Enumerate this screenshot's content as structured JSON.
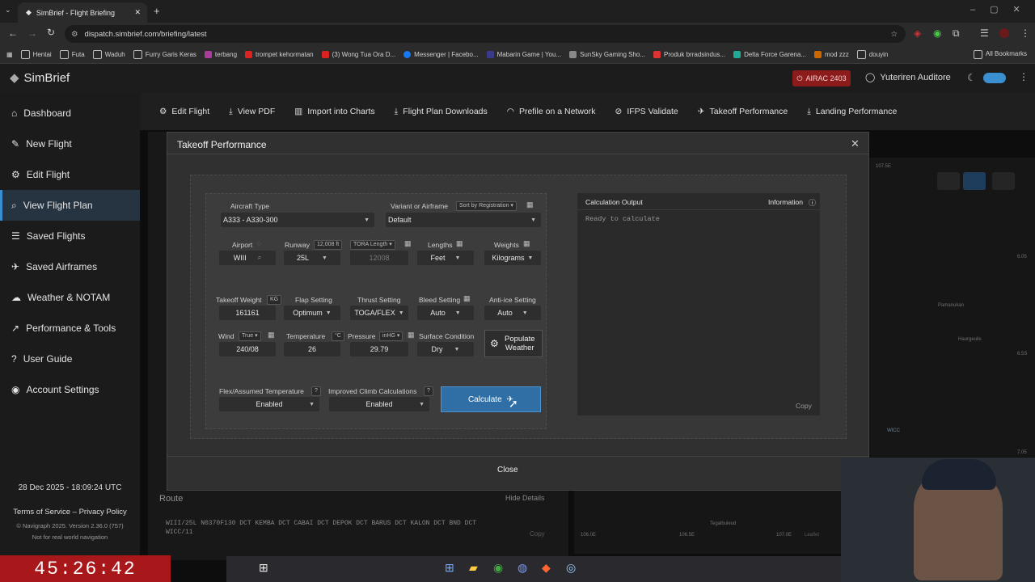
{
  "browser": {
    "tab_title": "SimBrief - Flight Briefing",
    "url": "dispatch.simbrief.com/briefing/latest",
    "bookmarks": [
      "Hentai",
      "Futa",
      "Waduh",
      "Furry Garis Keras",
      "terbang",
      "trompet kehormatan",
      "(3) Wong Tua Ora D...",
      "Messenger | Facebo...",
      "Mabarin Game | You...",
      "SunSky Gaming Sho...",
      "Produk brradsindus...",
      "Delta Force Garena...",
      "mod zzz",
      "douyin"
    ],
    "all_bookmarks": "All Bookmarks"
  },
  "app": {
    "logo": "SimBrief",
    "airac": "AIRAC 2403",
    "user": "Yuteriren Auditore"
  },
  "sidebar": {
    "items": [
      "Dashboard",
      "New Flight",
      "Edit Flight",
      "View Flight Plan",
      "Saved Flights",
      "Saved Airframes",
      "Weather & NOTAM",
      "Performance & Tools",
      "User Guide",
      "Account Settings"
    ],
    "date": "28 Dec 2025 - 18:09:24 UTC",
    "terms": "Terms of Service",
    "privacy": "Privacy Policy",
    "copyright": "© Navigraph 2025. Version 2.36.0 (757)",
    "notreal": "Not for real world navigation"
  },
  "topnav": [
    "Edit Flight",
    "View PDF",
    "Import into Charts",
    "Flight Plan Downloads",
    "Prefile on a Network",
    "IFPS Validate",
    "Takeoff Performance",
    "Landing Performance"
  ],
  "modal": {
    "title": "Takeoff Performance",
    "aircraft_type_label": "Aircraft Type",
    "aircraft_type": "A333 - A330-300",
    "variant_label": "Variant or Airframe",
    "variant_sort": "Sort by Registration",
    "variant": "Default",
    "airport_label": "Airport",
    "airport": "WIII",
    "runway_label": "Runway",
    "runway_len": "12,008 ft",
    "runway": "25L",
    "tora_label": "TORA Length",
    "tora": "12008",
    "lengths_label": "Lengths",
    "lengths": "Feet",
    "weights_label": "Weights",
    "weights": "Kilograms",
    "tow_label": "Takeoff Weight",
    "tow_unit": "KG",
    "tow": "161161",
    "flap_label": "Flap Setting",
    "flap": "Optimum",
    "thrust_label": "Thrust Setting",
    "thrust": "TOGA/FLEX",
    "bleed_label": "Bleed Setting",
    "bleed": "Auto",
    "antiice_label": "Anti-ice Setting",
    "antiice": "Auto",
    "wind_label": "Wind",
    "wind_mode": "True",
    "wind": "240/08",
    "temp_label": "Temperature",
    "temp_unit": "°C",
    "temp": "26",
    "pressure_label": "Pressure",
    "pressure_unit": "inHG",
    "pressure": "29.79",
    "surface_label": "Surface Condition",
    "surface": "Dry",
    "populate": "Populate Weather",
    "flex_label": "Flex/Assumed Temperature",
    "flex": "Enabled",
    "climb_label": "Improved Climb Calculations",
    "climb": "Enabled",
    "calculate": "Calculate",
    "output_label": "Calculation Output",
    "info_label": "Information",
    "output_text": "Ready to calculate",
    "copy": "Copy",
    "close": "Close"
  },
  "route": {
    "label": "Route",
    "hide": "Hide Details",
    "line1": "WIII/25L N0370F130 DCT KEMBA DCT CABAI DCT DEPOK DCT BARUS DCT KALON DCT BND DCT",
    "line2": "WICC/11",
    "copy": "Copy"
  },
  "map": {
    "labels": [
      "107.5E",
      "6.05",
      "Pamanukan",
      "Haurgeulis",
      "6.5S",
      "7.05",
      "WICC",
      "Tegalbuleud",
      "106.0E",
      "106.5E",
      "107.0E",
      "Leaflet"
    ]
  },
  "stream": {
    "timer": "45:26:42"
  },
  "colors": {
    "accent": "#3a8fd0",
    "airac": "#8c1c1c",
    "calc_button": "#2f6fa6",
    "timer_bg": "#a8181b"
  }
}
